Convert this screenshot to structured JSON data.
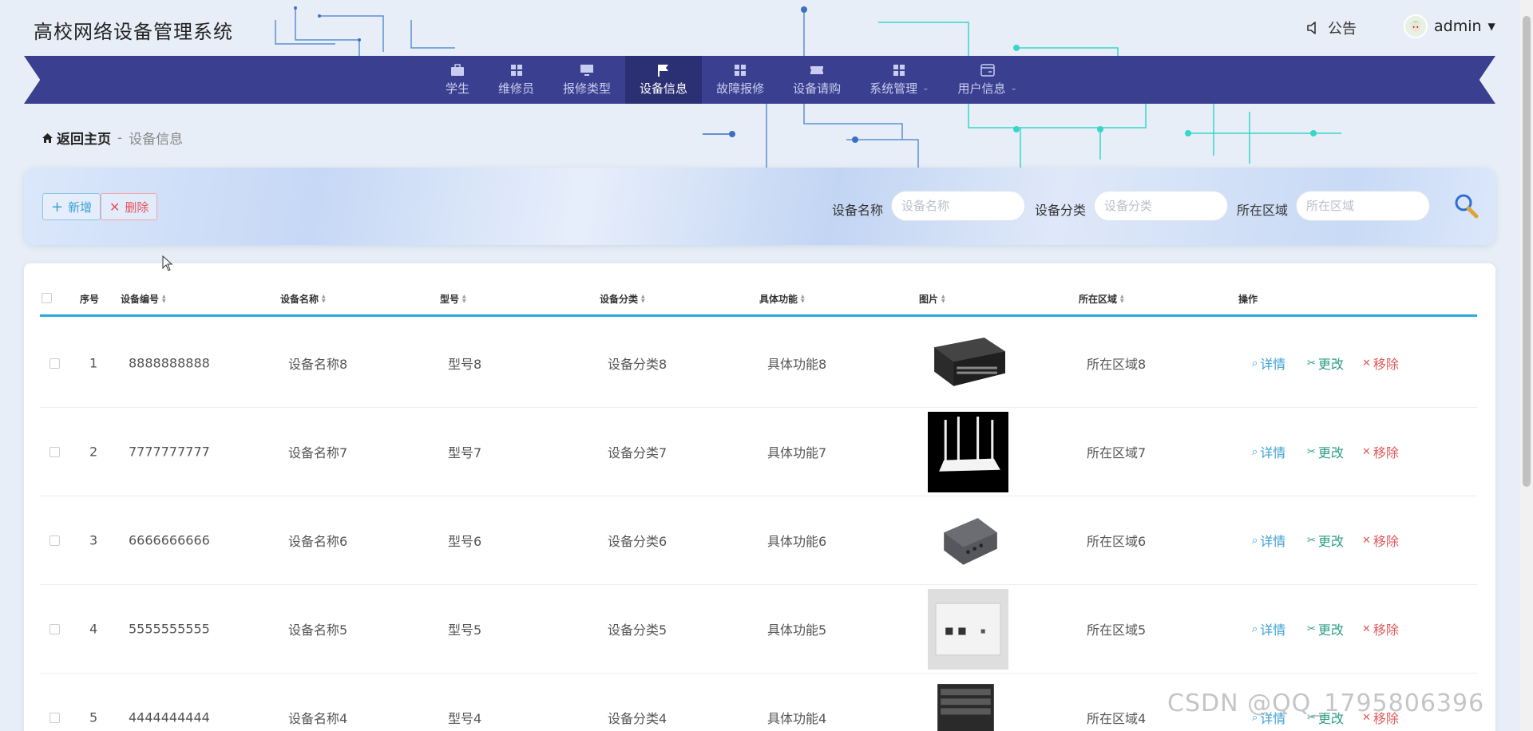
{
  "header": {
    "title": "高校网络设备管理系统",
    "notice_label": "公告",
    "user_name": "admin"
  },
  "nav": {
    "items": [
      {
        "label": "学生",
        "icon": "briefcase-icon",
        "active": false,
        "dropdown": false
      },
      {
        "label": "维修员",
        "icon": "grid-icon",
        "active": false,
        "dropdown": false
      },
      {
        "label": "报修类型",
        "icon": "monitor-icon",
        "active": false,
        "dropdown": false
      },
      {
        "label": "设备信息",
        "icon": "flag-icon",
        "active": true,
        "dropdown": false
      },
      {
        "label": "故障报修",
        "icon": "grid-icon",
        "active": false,
        "dropdown": false
      },
      {
        "label": "设备请购",
        "icon": "ticket-icon",
        "active": false,
        "dropdown": false
      },
      {
        "label": "系统管理",
        "icon": "grid-icon",
        "active": false,
        "dropdown": true
      },
      {
        "label": "用户信息",
        "icon": "card-icon",
        "active": false,
        "dropdown": true
      }
    ]
  },
  "breadcrumb": {
    "home": "返回主页",
    "separator": "-",
    "current": "设备信息"
  },
  "toolbar": {
    "add_label": "新增",
    "delete_label": "删除"
  },
  "search": {
    "fields": [
      {
        "label": "设备名称",
        "placeholder": "设备名称"
      },
      {
        "label": "设备分类",
        "placeholder": "设备分类"
      },
      {
        "label": "所在区域",
        "placeholder": "所在区域"
      }
    ]
  },
  "table": {
    "columns": [
      "序号",
      "设备编号",
      "设备名称",
      "型号",
      "设备分类",
      "具体功能",
      "图片",
      "所在区域",
      "操作"
    ],
    "rows": [
      {
        "index": "1",
        "code": "8888888888",
        "name": "设备名称8",
        "model": "型号8",
        "category": "设备分类8",
        "function": "具体功能8",
        "image": "network-switch",
        "region": "所在区域8"
      },
      {
        "index": "2",
        "code": "7777777777",
        "name": "设备名称7",
        "model": "型号7",
        "category": "设备分类7",
        "function": "具体功能7",
        "image": "wifi-router",
        "region": "所在区域7"
      },
      {
        "index": "3",
        "code": "6666666666",
        "name": "设备名称6",
        "model": "型号6",
        "category": "设备分类6",
        "function": "具体功能6",
        "image": "desktop-switch",
        "region": "所在区域6"
      },
      {
        "index": "4",
        "code": "5555555555",
        "name": "设备名称5",
        "model": "型号5",
        "category": "设备分类5",
        "function": "具体功能5",
        "image": "wall-box",
        "region": "所在区域5"
      },
      {
        "index": "5",
        "code": "4444444444",
        "name": "设备名称4",
        "model": "型号4",
        "category": "设备分类4",
        "function": "具体功能4",
        "image": "chassis-switch",
        "region": "所在区域4"
      }
    ],
    "actions": {
      "detail": "详情",
      "edit": "更改",
      "remove": "移除"
    }
  },
  "watermark": "CSDN @QQ_1795806396",
  "colors": {
    "nav_bg": "#3a3f8f",
    "nav_active": "#2b2f73",
    "accent": "#2aa8d8",
    "danger": "#e25a5a",
    "edit": "#2a9e86"
  }
}
